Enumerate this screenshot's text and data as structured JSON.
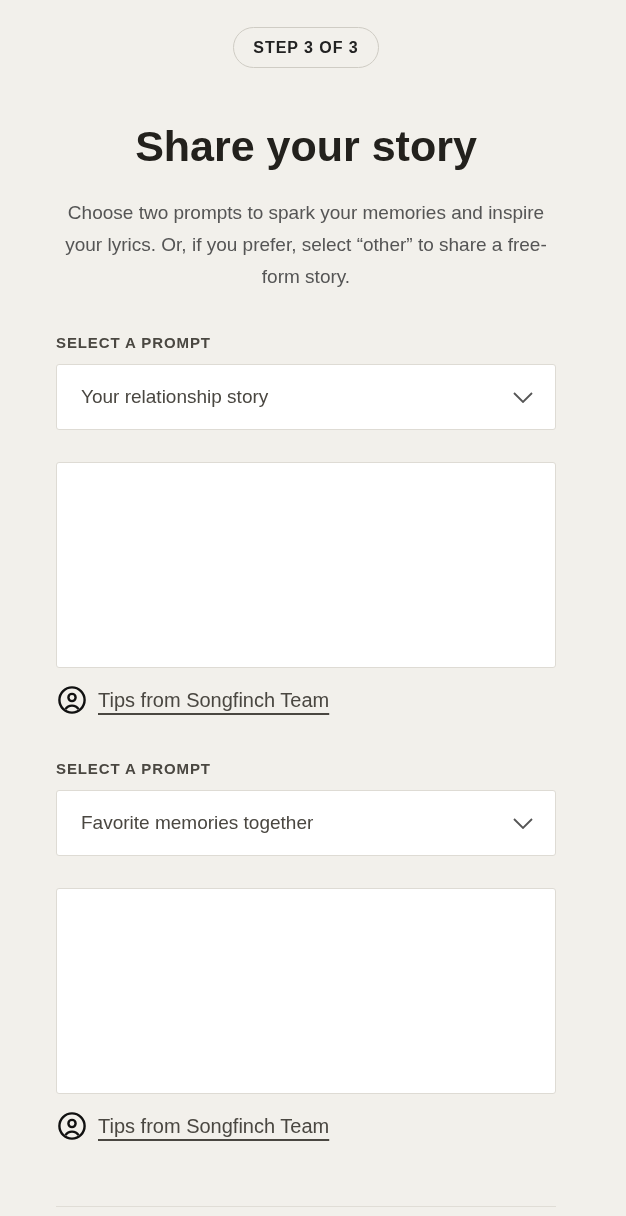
{
  "step_badge": "STEP 3 OF 3",
  "title": "Share your story",
  "intro": "Choose two prompts to spark your memories and inspire your lyrics. Or, if you prefer, select “other” to share a free-form story.",
  "prompts": [
    {
      "label": "SELECT A PROMPT",
      "select_value": "Your relationship story",
      "tips_link": "Tips from Songfinch Team"
    },
    {
      "label": "SELECT A PROMPT",
      "select_value": "Favorite memories together",
      "tips_link": "Tips from Songfinch Team"
    }
  ]
}
